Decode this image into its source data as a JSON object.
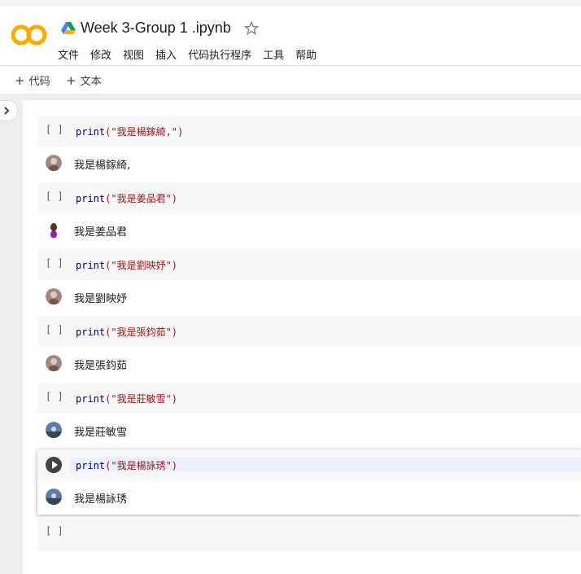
{
  "header": {
    "doc_title": "Week 3-Group 1 .ipynb",
    "menu": [
      "文件",
      "修改",
      "视图",
      "插入",
      "代码执行程序",
      "工具",
      "帮助"
    ]
  },
  "toolbar": {
    "add_code_label": "代码",
    "add_text_label": "文本"
  },
  "cells": [
    {
      "brackets": "[ ]",
      "code_fn": "print",
      "code_arg": "(\"我是楊鎵綺,\")",
      "output": "我是楊鎵綺,",
      "avatar_color": "#a1887f"
    },
    {
      "brackets": "[ ]",
      "code_fn": "print",
      "code_arg": "(\"我是姜品君\")",
      "output": "我是姜品君",
      "avatar_color": "#6d4c41"
    },
    {
      "brackets": "[ ]",
      "code_fn": "print",
      "code_arg": "(\"我是劉映妤\")",
      "output": "我是劉映妤",
      "avatar_color": "#a1887f"
    },
    {
      "brackets": "[ ]",
      "code_fn": "print",
      "code_arg": "(\"我是張鈞茹\")",
      "output": "我是張鈞茹",
      "avatar_color": "#a1887f"
    },
    {
      "brackets": "[ ]",
      "code_fn": "print",
      "code_arg": "(\"我是莊敏雪\")",
      "output": "我是莊敏雪",
      "avatar_color": "#5c7ea6"
    },
    {
      "brackets": "",
      "code_fn": "print",
      "code_arg": "(\"我是楊詠琇\")",
      "output": "我是楊詠琇",
      "avatar_color": "#5c7ea6"
    }
  ],
  "empty_cell": {
    "brackets": "[ ]"
  }
}
